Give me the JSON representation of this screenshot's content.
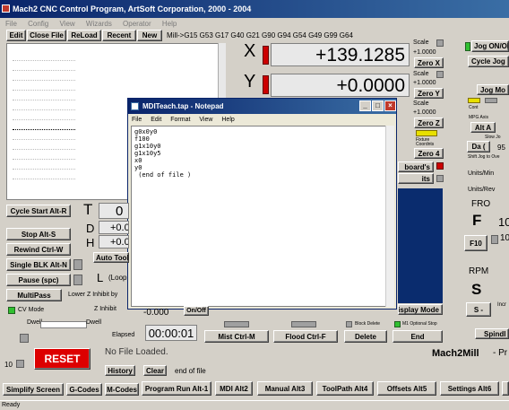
{
  "window": {
    "title": "Mach2 CNC Control Program, ArtSoft Corporation, 2000 - 2004"
  },
  "menu": [
    "File",
    "Config",
    "View",
    "Wizards",
    "Operator",
    "Help"
  ],
  "file_toolbar": {
    "edit": "Edit",
    "close_file": "Close File",
    "reload": "ReLoad",
    "recent": "Recent",
    "new": "New"
  },
  "modal_codes": "Mill->G15  G53 G17 G40 G21 G90 G94 G54 G49 G99 G64",
  "dro": {
    "x_label": "X",
    "x_value": "+139.1285",
    "y_label": "Y",
    "y_value": "+0.0000"
  },
  "scale": {
    "label": "Scale",
    "values": [
      "+1.0000",
      "+1.0000",
      "+1.0000"
    ]
  },
  "zero_buttons": [
    "Zero X",
    "Zero Y",
    "Zero Z",
    "Zero 4"
  ],
  "zero_z_partial": "Zero Z",
  "partial_buttons": {
    "keyboard": "board's",
    "limits": "its",
    "display_mode": "isplay Mode"
  },
  "notepad": {
    "title": "MDITeach.tap - Notepad",
    "menu": [
      "File",
      "Edit",
      "Format",
      "View",
      "Help"
    ],
    "content": "g0x0y0\nf100\ng1x10y0\ng1x10y5\nx0\ny0\n (end of file )"
  },
  "left_controls": {
    "cycle_start": "Cycle Start Alt-R",
    "stop": "Stop Alt-S",
    "rewind": "Rewind Ctrl-W",
    "single_blk": "Single BLK Alt-N",
    "pause": "Pause (spc)",
    "multipass": "MultiPass",
    "lower_z": "Lower Z Inhibit by",
    "cv_mode": "CV Mode",
    "dwell": "Dwell"
  },
  "tdh": {
    "t_label": "T",
    "t_value": "0",
    "d_label": "D",
    "d_value": "+0.0",
    "h_label": "H",
    "h_value": "+0.0",
    "auto_tool": "Auto Tool",
    "l_label": "L",
    "l_value": "(Loop",
    "z_inhibit": "Z Inhibit",
    "z_inhibit_value": "-0.000",
    "on_off": "On/Off"
  },
  "elapsed": {
    "label": "Elapsed",
    "value": "00:00:01"
  },
  "bottom_controls": {
    "mist": "Mist Ctrl-M",
    "flood": "Flood Ctrl-F",
    "delete": "Delete",
    "end": "End",
    "block_delete": "Block Delete",
    "m1_optional": "M1 Optional Stop",
    "reset": "RESET",
    "file_loaded": "No File Loaded.",
    "history": "History",
    "clear": "Clear",
    "end_of_file": "end of file",
    "reset_count": "10"
  },
  "brand": "Mach2Mill",
  "brand_partial": "- Pr",
  "tabs": [
    "Simplify Screen",
    "G-Codes",
    "M-Codes",
    "Program Run Alt-1",
    "MDI Alt2",
    "Manual Alt3",
    "ToolPath Alt4",
    "Offsets Alt5",
    "Settings Alt6"
  ],
  "right_panel": {
    "jog_toggle": "Jog ON/OFF",
    "cycle_jog": "Cycle Jog",
    "jog_mode": "Jog Mo",
    "cont": "Cont",
    "mpg_axis": "MPG Axis",
    "alt_a": "Alt A",
    "slow_jog": "Slow Jo",
    "da": "Da (",
    "da_value": "95",
    "shift_jog": "Shift Jog to Ove",
    "units_min": "Units/Min",
    "units_rev": "Units/Rev",
    "fro": "FRO",
    "f_label": "F",
    "f_value": "10",
    "f10": "F10",
    "f10_value": "10",
    "rpm": "RPM",
    "s_label": "S",
    "s_minus": "S -",
    "incr": "Incr",
    "spindle": "Spindl"
  },
  "small_labels": {
    "fixture": "Fixture",
    "coords": "Coordnts"
  },
  "status_bar": "Ready"
}
